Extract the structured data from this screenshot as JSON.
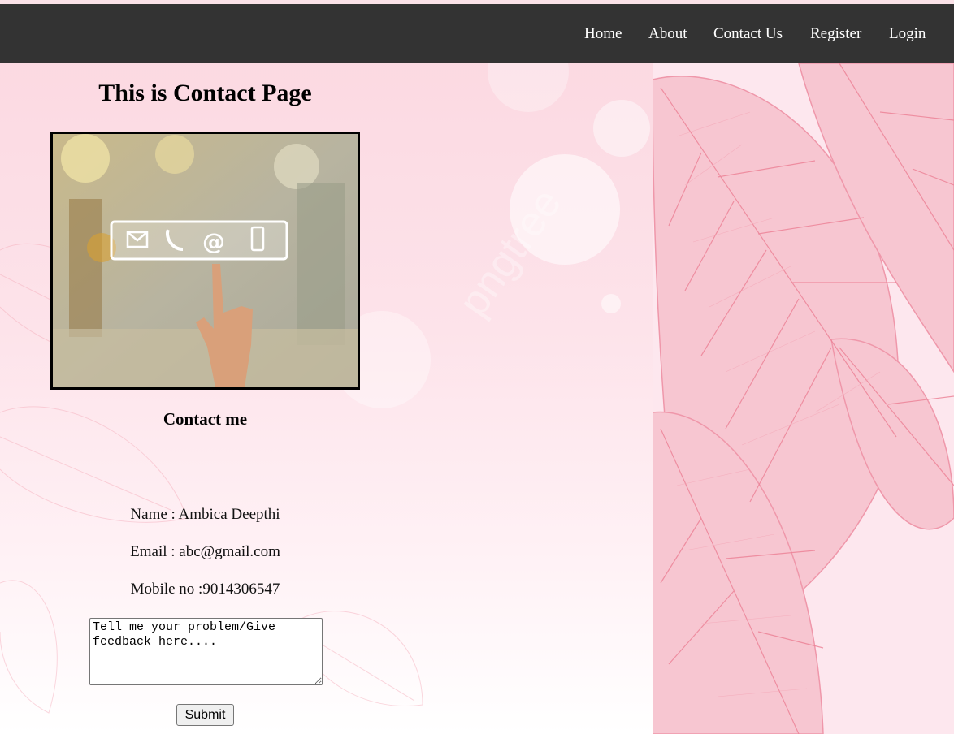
{
  "nav": {
    "items": [
      {
        "label": "Home"
      },
      {
        "label": "About"
      },
      {
        "label": "Contact Us"
      },
      {
        "label": "Register"
      },
      {
        "label": "Login"
      }
    ]
  },
  "main": {
    "title": "This is Contact Page",
    "image_icons": [
      "envelope-icon",
      "phone-icon",
      "at-sign-icon",
      "mobile-icon"
    ],
    "contact_heading": "Contact me",
    "name_line": "Name : Ambica Deepthi",
    "email_line": "Email : abc@gmail.com",
    "mobile_line": "Mobile no :9014306547",
    "feedback_placeholder": "Tell me your problem/Give feedback here....",
    "feedback_value": "",
    "submit_label": "Submit"
  },
  "background": {
    "watermark": "pngtree"
  },
  "colors": {
    "navbar": "#333333",
    "nav_text": "#ffffff",
    "background_pink": "#fbd7e0",
    "leaf_pink": "#f08a9e"
  }
}
